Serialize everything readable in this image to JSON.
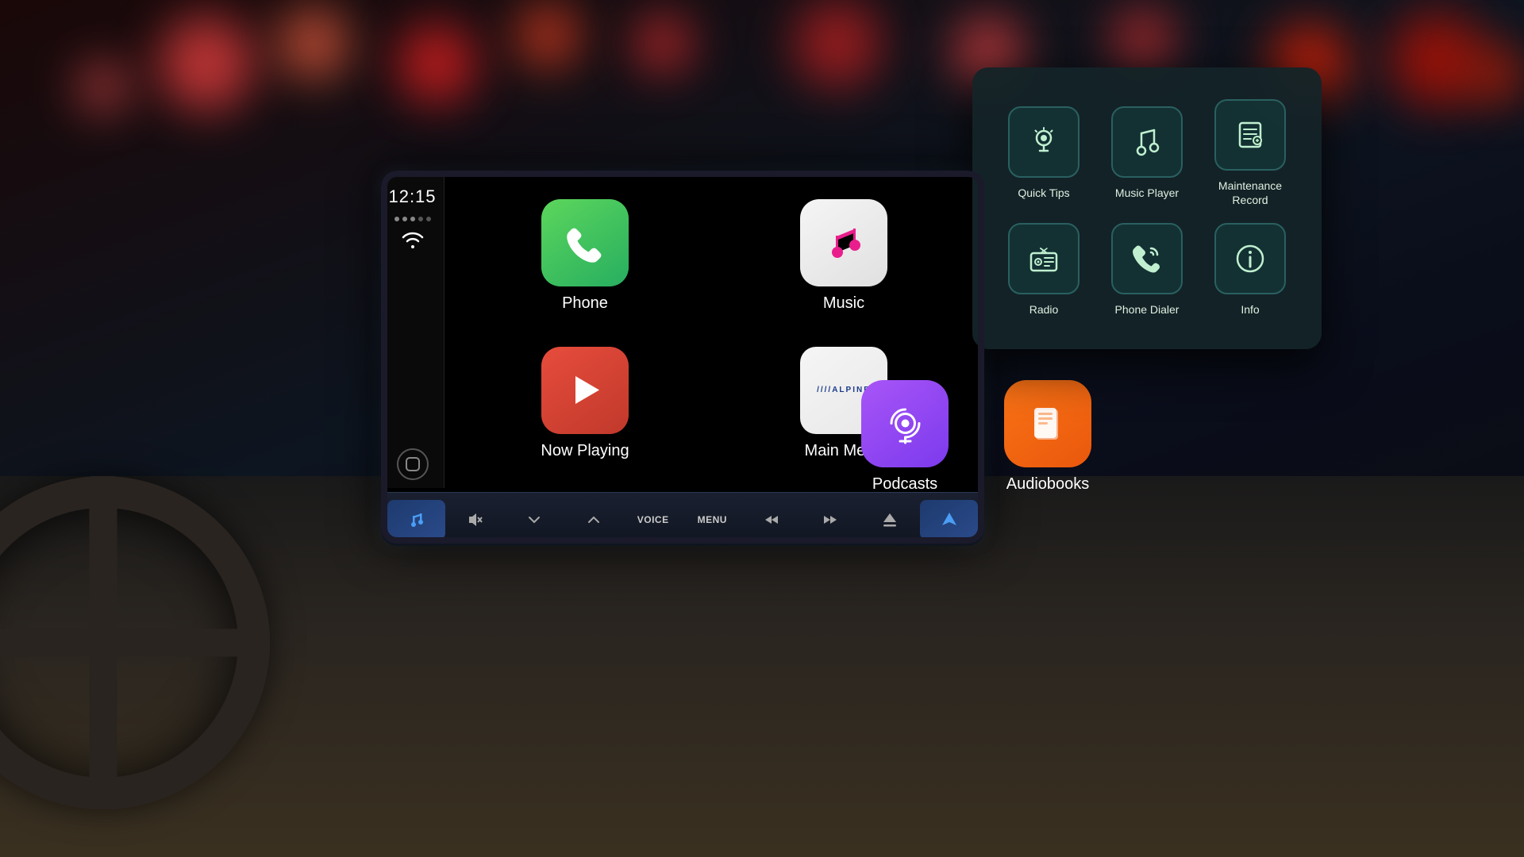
{
  "background": {
    "bokeh_color": "#ff3333"
  },
  "time": "12:15",
  "car_display": {
    "apps": [
      {
        "id": "phone",
        "label": "Phone",
        "icon": "📞",
        "color_class": "phone"
      },
      {
        "id": "music",
        "label": "Music",
        "icon": "🎵",
        "color_class": "music"
      },
      {
        "id": "now-playing",
        "label": "Now Playing",
        "icon": "▶",
        "color_class": "now-playing"
      },
      {
        "id": "main-menu",
        "label": "Main Menu",
        "icon": "ALPINE",
        "color_class": "main-menu"
      }
    ],
    "extended_apps": [
      {
        "id": "podcasts",
        "label": "Podcasts",
        "icon": "🎙",
        "color_class": "podcasts"
      },
      {
        "id": "audiobooks",
        "label": "Audiobooks",
        "icon": "📖",
        "color_class": "audiobooks"
      }
    ]
  },
  "control_bar": {
    "buttons": [
      {
        "id": "music-btn",
        "icon": "♪",
        "active": true
      },
      {
        "id": "mute-btn",
        "icon": "🔇",
        "active": false
      },
      {
        "id": "prev-btn",
        "icon": "∨",
        "active": false
      },
      {
        "id": "next-btn",
        "icon": "∧",
        "active": false
      },
      {
        "id": "voice-btn",
        "label": "VOICE",
        "active": false
      },
      {
        "id": "menu-btn",
        "label": "MENU",
        "active": false
      },
      {
        "id": "rew-btn",
        "icon": "⏮",
        "active": false
      },
      {
        "id": "fwd-btn",
        "icon": "⏭",
        "active": false
      },
      {
        "id": "eject-btn",
        "icon": "⏏",
        "active": false
      },
      {
        "id": "nav-btn",
        "icon": "▲",
        "active": true
      }
    ]
  },
  "popup_menu": {
    "items": [
      {
        "id": "quick-tips",
        "label": "Quick Tips",
        "icon": "💡"
      },
      {
        "id": "music-player",
        "label": "Music Player",
        "icon": "♪"
      },
      {
        "id": "maintenance-record",
        "label": "Maintenance Record",
        "icon": "⚙"
      },
      {
        "id": "radio",
        "label": "Radio",
        "icon": "📺"
      },
      {
        "id": "phone-dialer",
        "label": "Phone Dialer",
        "icon": "📞"
      },
      {
        "id": "info",
        "label": "Info",
        "icon": "ℹ"
      }
    ]
  }
}
